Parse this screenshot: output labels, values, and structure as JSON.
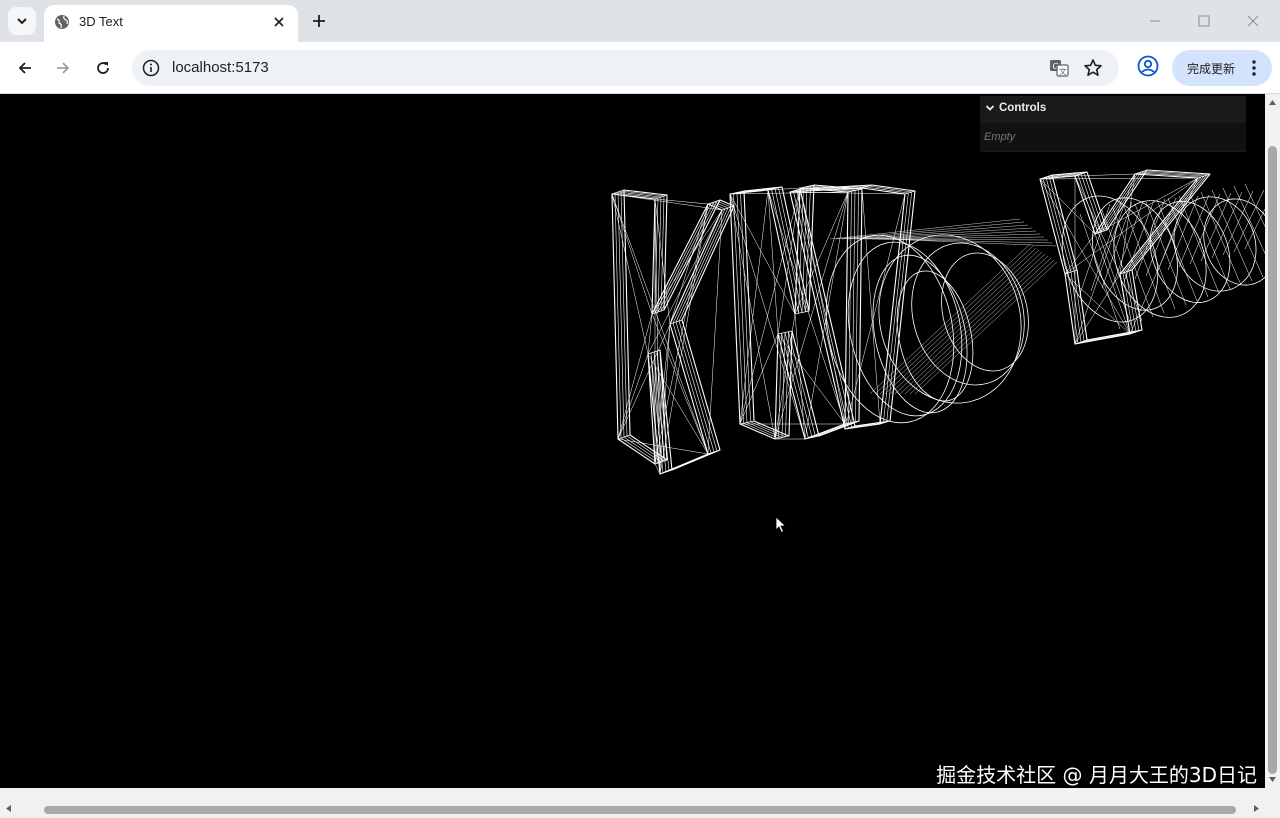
{
  "browser": {
    "tab": {
      "title": "3D Text",
      "favicon": "globe-icon"
    },
    "new_tab_icon": "plus-icon",
    "address": {
      "url": "localhost:5173",
      "info_icon": "info-icon"
    },
    "update_button": {
      "label": "完成更新"
    },
    "icons": [
      "chevron-down-icon",
      "close-icon",
      "back-arrow-icon",
      "forward-arrow-icon",
      "reload-icon",
      "translate-icon",
      "star-icon",
      "profile-icon",
      "more-vert-icon",
      "minimize-icon",
      "maximize-icon"
    ]
  },
  "controls": {
    "title": "Controls",
    "empty_text": "Empty"
  },
  "watermark": "掘金技术社区 @ 月月大王的3D日记",
  "colors": {
    "canvas_bg": "#000000",
    "wire": "#ffffff",
    "update_button_bg": "#d3e3fd",
    "panel_bg": "#1a1a1a"
  }
}
